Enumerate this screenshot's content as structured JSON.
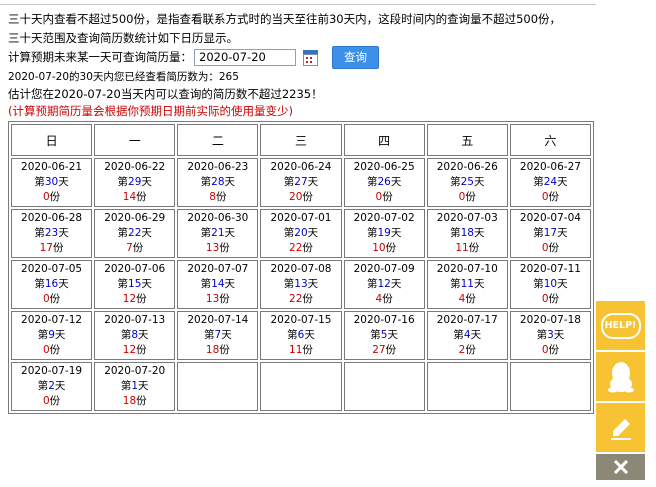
{
  "intro": {
    "line1": "三十天内查看不超过500份，是指查看联系方式时的当天至往前30天内，这段时间内的查询量不超过500份，",
    "line2": "三十天范围及查询简历数统计如下日历显示。"
  },
  "query": {
    "label": "计算预期未来某一天可查询简历量：",
    "date_value": "2020-07-20",
    "button": "查询"
  },
  "summary": {
    "line1": "2020-07-20的30天内您已经查看简历数为：265",
    "line2": "估计您在2020-07-20当天内可以查询的简历数不超过2235！",
    "note": "(计算预期简历量会根据你预期日期前实际的使用量变少)"
  },
  "calendar": {
    "weekdays": [
      "日",
      "一",
      "二",
      "三",
      "四",
      "五",
      "六"
    ],
    "rows": [
      [
        {
          "date": "2020-06-21",
          "day": "第30天",
          "count": "0份"
        },
        {
          "date": "2020-06-22",
          "day": "第29天",
          "count": "14份"
        },
        {
          "date": "2020-06-23",
          "day": "第28天",
          "count": "8份"
        },
        {
          "date": "2020-06-24",
          "day": "第27天",
          "count": "20份"
        },
        {
          "date": "2020-06-25",
          "day": "第26天",
          "count": "0份"
        },
        {
          "date": "2020-06-26",
          "day": "第25天",
          "count": "0份"
        },
        {
          "date": "2020-06-27",
          "day": "第24天",
          "count": "0份"
        }
      ],
      [
        {
          "date": "2020-06-28",
          "day": "第23天",
          "count": "17份"
        },
        {
          "date": "2020-06-29",
          "day": "第22天",
          "count": "7份"
        },
        {
          "date": "2020-06-30",
          "day": "第21天",
          "count": "13份"
        },
        {
          "date": "2020-07-01",
          "day": "第20天",
          "count": "22份"
        },
        {
          "date": "2020-07-02",
          "day": "第19天",
          "count": "10份"
        },
        {
          "date": "2020-07-03",
          "day": "第18天",
          "count": "11份"
        },
        {
          "date": "2020-07-04",
          "day": "第17天",
          "count": "0份"
        }
      ],
      [
        {
          "date": "2020-07-05",
          "day": "第16天",
          "count": "0份"
        },
        {
          "date": "2020-07-06",
          "day": "第15天",
          "count": "12份"
        },
        {
          "date": "2020-07-07",
          "day": "第14天",
          "count": "13份"
        },
        {
          "date": "2020-07-08",
          "day": "第13天",
          "count": "22份"
        },
        {
          "date": "2020-07-09",
          "day": "第12天",
          "count": "4份"
        },
        {
          "date": "2020-07-10",
          "day": "第11天",
          "count": "4份"
        },
        {
          "date": "2020-07-11",
          "day": "第10天",
          "count": "0份"
        }
      ],
      [
        {
          "date": "2020-07-12",
          "day": "第9天",
          "count": "0份"
        },
        {
          "date": "2020-07-13",
          "day": "第8天",
          "count": "12份"
        },
        {
          "date": "2020-07-14",
          "day": "第7天",
          "count": "18份"
        },
        {
          "date": "2020-07-15",
          "day": "第6天",
          "count": "11份"
        },
        {
          "date": "2020-07-16",
          "day": "第5天",
          "count": "27份"
        },
        {
          "date": "2020-07-17",
          "day": "第4天",
          "count": "2份"
        },
        {
          "date": "2020-07-18",
          "day": "第3天",
          "count": "0份"
        }
      ],
      [
        {
          "date": "2020-07-19",
          "day": "第2天",
          "count": "0份"
        },
        {
          "date": "2020-07-20",
          "day": "第1天",
          "count": "18份"
        },
        null,
        null,
        null,
        null,
        null
      ]
    ]
  },
  "sidebar": {
    "help_label": "HELP!",
    "icons": [
      "help-icon",
      "qq-icon",
      "pencil-icon",
      "close-icon"
    ]
  }
}
